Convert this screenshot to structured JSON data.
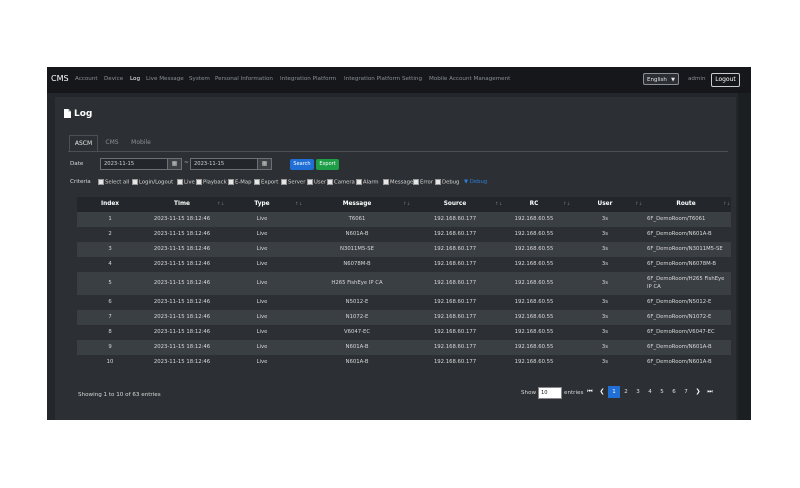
{
  "nav": {
    "brand": "CMS",
    "items": [
      "Account",
      "Device",
      "Log",
      "Live Message",
      "System",
      "Personal Information",
      "Integration Platform",
      "Integration Platform Setting",
      "Mobile Account Management"
    ],
    "active_index": 2,
    "language": "English",
    "user": "admin",
    "logout_label": "Logout"
  },
  "page": {
    "title": "Log",
    "title_icon": "file-icon",
    "tabs": [
      "ASCM",
      "CMS",
      "Mobile"
    ],
    "active_tab": 0
  },
  "filters": {
    "date_label": "Date",
    "date_from": "2023-11-15",
    "date_separator": "~",
    "date_to": "2023-11-15",
    "search_label": "Search",
    "export_label": "Export",
    "criteria_label": "Criteria",
    "criteria": [
      "Select all",
      "Login/Logout",
      "Live",
      "Playback",
      "E-Map",
      "Export",
      "Server",
      "User",
      "Camera",
      "Alarm",
      "Message",
      "Error",
      "Debug"
    ],
    "criteria_link": "Debug"
  },
  "table": {
    "columns": [
      "Index",
      "Time",
      "Type",
      "Message",
      "Source",
      "RC",
      "User",
      "Route"
    ],
    "rows": [
      {
        "index": "1",
        "time": "2023-11-15 18:12:46",
        "type": "Live",
        "message": "T6061",
        "source": "192.168.60.177",
        "rc": "192.168.60.55",
        "user": "3s",
        "route": "6F_DemoRoom/T6061"
      },
      {
        "index": "2",
        "time": "2023-11-15 18:12:46",
        "type": "Live",
        "message": "N601A-B",
        "source": "192.168.60.177",
        "rc": "192.168.60.55",
        "user": "3s",
        "route": "6F_DemoRoom/N601A-B"
      },
      {
        "index": "3",
        "time": "2023-11-15 18:12:46",
        "type": "Live",
        "message": "N3011M5-SE",
        "source": "192.168.60.177",
        "rc": "192.168.60.55",
        "user": "3s",
        "route": "6F_DemoRoom/N3011M5-SE"
      },
      {
        "index": "4",
        "time": "2023-11-15 18:12:46",
        "type": "Live",
        "message": "N6078M-B",
        "source": "192.168.60.177",
        "rc": "192.168.60.55",
        "user": "3s",
        "route": "6F_DemoRoom/N6078M-B"
      },
      {
        "index": "5",
        "time": "2023-11-15 18:12:46",
        "type": "Live",
        "message": "H265 FishEye IP CA",
        "source": "192.168.60.177",
        "rc": "192.168.60.55",
        "user": "3s",
        "route": "6F_DemoRoom/H265 FishEye IP CA"
      },
      {
        "index": "6",
        "time": "2023-11-15 18:12:46",
        "type": "Live",
        "message": "N5012-E",
        "source": "192.168.60.177",
        "rc": "192.168.60.55",
        "user": "3s",
        "route": "6F_DemoRoom/N5012-E"
      },
      {
        "index": "7",
        "time": "2023-11-15 18:12:46",
        "type": "Live",
        "message": "N1072-E",
        "source": "192.168.60.177",
        "rc": "192.168.60.55",
        "user": "3s",
        "route": "6F_DemoRoom/N1072-E"
      },
      {
        "index": "8",
        "time": "2023-11-15 18:12:46",
        "type": "Live",
        "message": "V6047-EC",
        "source": "192.168.60.177",
        "rc": "192.168.60.55",
        "user": "3s",
        "route": "6F_DemoRoom/V6047-EC"
      },
      {
        "index": "9",
        "time": "2023-11-15 18:12:46",
        "type": "Live",
        "message": "N601A-B",
        "source": "192.168.60.177",
        "rc": "192.168.60.55",
        "user": "3s",
        "route": "6F_DemoRoom/N601A-B"
      },
      {
        "index": "10",
        "time": "2023-11-15 18:12:46",
        "type": "Live",
        "message": "N601A-B",
        "source": "192.168.60.177",
        "rc": "192.168.60.55",
        "user": "3s",
        "route": "6F_DemoRoom/N601A-B"
      }
    ]
  },
  "footer": {
    "showing": "Showing 1 to 10 of 63 entries",
    "show_label": "Show",
    "show_value": "10",
    "entries_label": "entries",
    "pages": [
      "1",
      "2",
      "3",
      "4",
      "5",
      "6",
      "7"
    ],
    "active_page": "1"
  },
  "colors": {
    "nav_bg": "#15171a",
    "card_bg": "#2c3034",
    "primary": "#1f6fd6",
    "success": "#1e9e46"
  }
}
